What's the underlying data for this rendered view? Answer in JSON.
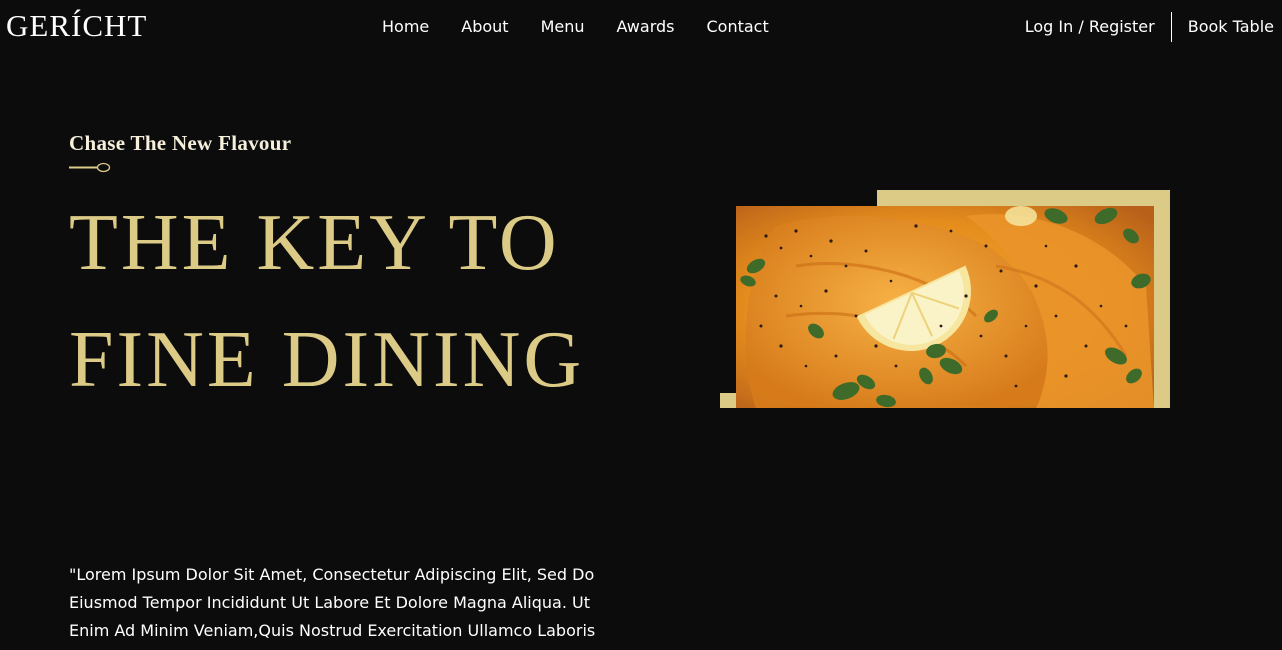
{
  "brand": {
    "logo": "GERÍCHT"
  },
  "nav": {
    "links": [
      "Home",
      "About",
      "Menu",
      "Awards",
      "Contact"
    ],
    "login": "Log In / Register",
    "book": "Book Table"
  },
  "hero": {
    "subtitle": "Chase The New Flavour",
    "title": "THE KEY TO FINE DINING",
    "text": "\"Lorem Ipsum Dolor Sit Amet, Consectetur Adipiscing Elit, Sed Do Eiusmod Tempor Incididunt Ut Labore Et Dolore Magna Aliqua. Ut Enim Ad Minim Veniam,Quis Nostrud Exercitation Ullamco Laboris",
    "image_icon": "food-image"
  },
  "colors": {
    "background": "#0c0c0c",
    "golden": "#dcca87",
    "white": "#ffffff"
  }
}
